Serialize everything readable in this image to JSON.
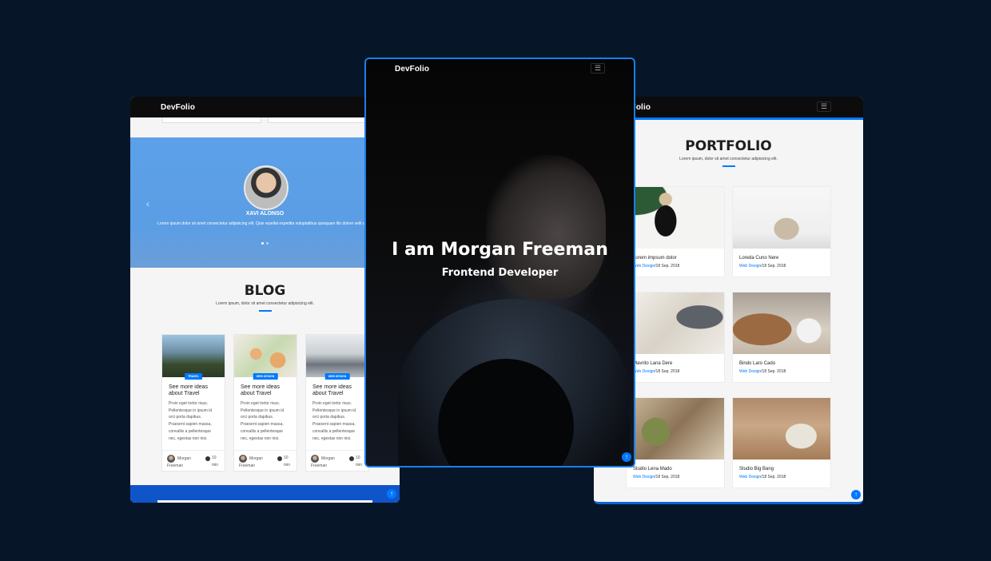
{
  "left": {
    "brand": "DevFolio",
    "testimonial": {
      "name": "XAVI ALONSO",
      "text": "Lorem ipsum dolor sit amet consectetur adipisicing elit. Quis repellat expedita voluptatibus quisquam illo dolore velit ullam"
    },
    "blog": {
      "title": "BLOG",
      "subtitle": "Lorem ipsum, dolor sit amet consectetur adipisicing elit."
    },
    "cards": [
      {
        "badge": "TRAVEL",
        "title": "See more ideas about Travel",
        "text": "Proin eget tortor risus. Pellentesque in ipsum id orci porta dapibus. Praesent sapien massa, convallis a pellentesque nec, egestas non nisi.",
        "author": "Morgan Freeman",
        "time": "10 min"
      },
      {
        "badge": "WEB DESIGN",
        "title": "See more ideas about Travel",
        "text": "Proin eget tortor risus. Pellentesque in ipsum id orci porta dapibus. Praesent sapien massa, convallis a pellentesque nec, egestas non nisi.",
        "author": "Morgan Freeman",
        "time": "10 min"
      },
      {
        "badge": "WEB DESIGN",
        "title": "See more ideas about Travel",
        "text": "Proin eget tortor risus. Pellentesque in ipsum id orci porta dapibus. Praesent sapien massa, convallis a pellentesque nec, egestas non nisi.",
        "author": "Morgan Freeman",
        "time": "10 min"
      }
    ]
  },
  "center": {
    "brand": "DevFolio",
    "hero_title": "I am Morgan Freeman",
    "hero_subtitle": "Frontend Developer"
  },
  "right": {
    "brand": "DevFolio",
    "portfolio": {
      "title": "PORTFOLIO",
      "subtitle": "Lorem ipsum, dolor sit amet consectetur adipisicing elit."
    },
    "items": [
      {
        "title": "Lorem impsum dolor",
        "category": "Web Design",
        "date": "/18 Sep. 2018"
      },
      {
        "title": "Loreda Cuno Nere",
        "category": "Web Design",
        "date": "/18 Sep. 2018"
      },
      {
        "title": "Mavrito Lana Dere",
        "category": "Web Design",
        "date": "/18 Sep. 2018"
      },
      {
        "title": "Bindo Laro Cado",
        "category": "Web Design",
        "date": "/18 Sep. 2018"
      },
      {
        "title": "Studio Lena Mado",
        "category": "Web Design",
        "date": "/18 Sep. 2018"
      },
      {
        "title": "Studio Big Bang",
        "category": "Web Design",
        "date": "/18 Sep. 2018"
      }
    ]
  },
  "icons": {
    "menu": "☰",
    "arrow_up": "↑",
    "chevron_left": "‹"
  }
}
